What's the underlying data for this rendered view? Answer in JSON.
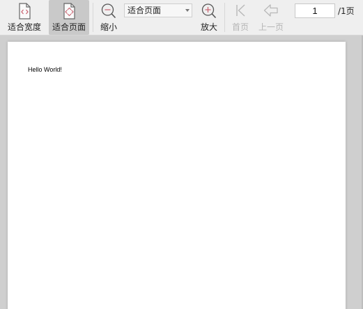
{
  "toolbar": {
    "fit_width_label": "适合宽度",
    "fit_page_label": "适合页面",
    "zoom_out_label": "缩小",
    "zoom_select_value": "适合页面",
    "zoom_in_label": "放大",
    "first_page_label": "首页",
    "prev_page_label": "上一页",
    "page_number": "1",
    "page_total": "/1页",
    "accent_color": "#c9606e"
  },
  "document": {
    "text": "Hello World!"
  }
}
